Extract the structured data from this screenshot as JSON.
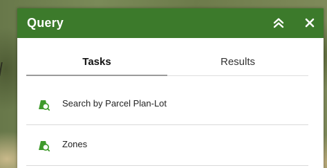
{
  "colors": {
    "header_bg": "#3c7a2b",
    "header_text": "#ffffff",
    "icon_green": "#3e9a2b",
    "active_underline": "#9a9a9a"
  },
  "widget": {
    "title": "Query",
    "collapse_icon": "double-chevron-up-icon",
    "close_icon": "close-icon"
  },
  "tabs": [
    {
      "label": "Tasks",
      "active": true
    },
    {
      "label": "Results",
      "active": false
    }
  ],
  "tasks": [
    {
      "label": "Search by Parcel Plan-Lot",
      "icon": "layer-search-icon"
    },
    {
      "label": "Zones",
      "icon": "layer-search-icon"
    }
  ]
}
